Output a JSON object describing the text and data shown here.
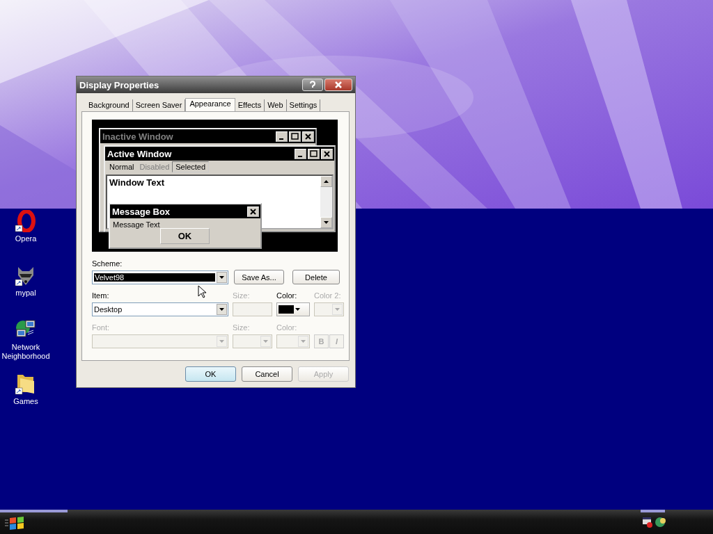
{
  "window": {
    "title": "Display Properties"
  },
  "tabs": [
    {
      "label": "Background",
      "selected": false
    },
    {
      "label": "Screen Saver",
      "selected": false
    },
    {
      "label": "Appearance",
      "selected": true
    },
    {
      "label": "Effects",
      "selected": false
    },
    {
      "label": "Web",
      "selected": false
    },
    {
      "label": "Settings",
      "selected": false
    }
  ],
  "preview": {
    "inactive_title": "Inactive Window",
    "active_title": "Active Window",
    "menu": [
      {
        "label": "Normal",
        "kind": "normal"
      },
      {
        "label": "Disabled",
        "kind": "disabled"
      },
      {
        "label": "Selected",
        "kind": "selected"
      }
    ],
    "window_text": "Window Text",
    "message_box": {
      "title": "Message Box",
      "text": "Message Text",
      "button": "OK"
    }
  },
  "scheme": {
    "label": "Scheme:",
    "value": "Velvet98",
    "buttons": [
      "Save As...",
      "Delete"
    ]
  },
  "item": {
    "label": "Item:",
    "value": "Desktop"
  },
  "item_size": {
    "label": "Size:",
    "disabled": true
  },
  "item_color": {
    "label": "Color:",
    "disabled": false,
    "color": "#000000"
  },
  "item_color2": {
    "label": "Color 2:",
    "disabled": true
  },
  "font": {
    "label": "Font:",
    "disabled": true
  },
  "font_size": {
    "label": "Size:",
    "disabled": true
  },
  "font_color": {
    "label": "Color:",
    "disabled": true
  },
  "style_buttons": [
    {
      "label": "B",
      "disabled": true
    },
    {
      "label": "I",
      "disabled": true
    }
  ],
  "buttons": [
    {
      "label": "OK",
      "kind": "default",
      "disabled": false
    },
    {
      "label": "Cancel",
      "kind": "normal",
      "disabled": false
    },
    {
      "label": "Apply",
      "kind": "normal",
      "disabled": true
    }
  ],
  "desktop_icons": [
    {
      "label": "Opera",
      "kind": "opera"
    },
    {
      "label": "mypal",
      "kind": "animal"
    },
    {
      "label": "Network Neighborhood",
      "kind": "network"
    },
    {
      "label": "Games",
      "kind": "folder"
    }
  ]
}
